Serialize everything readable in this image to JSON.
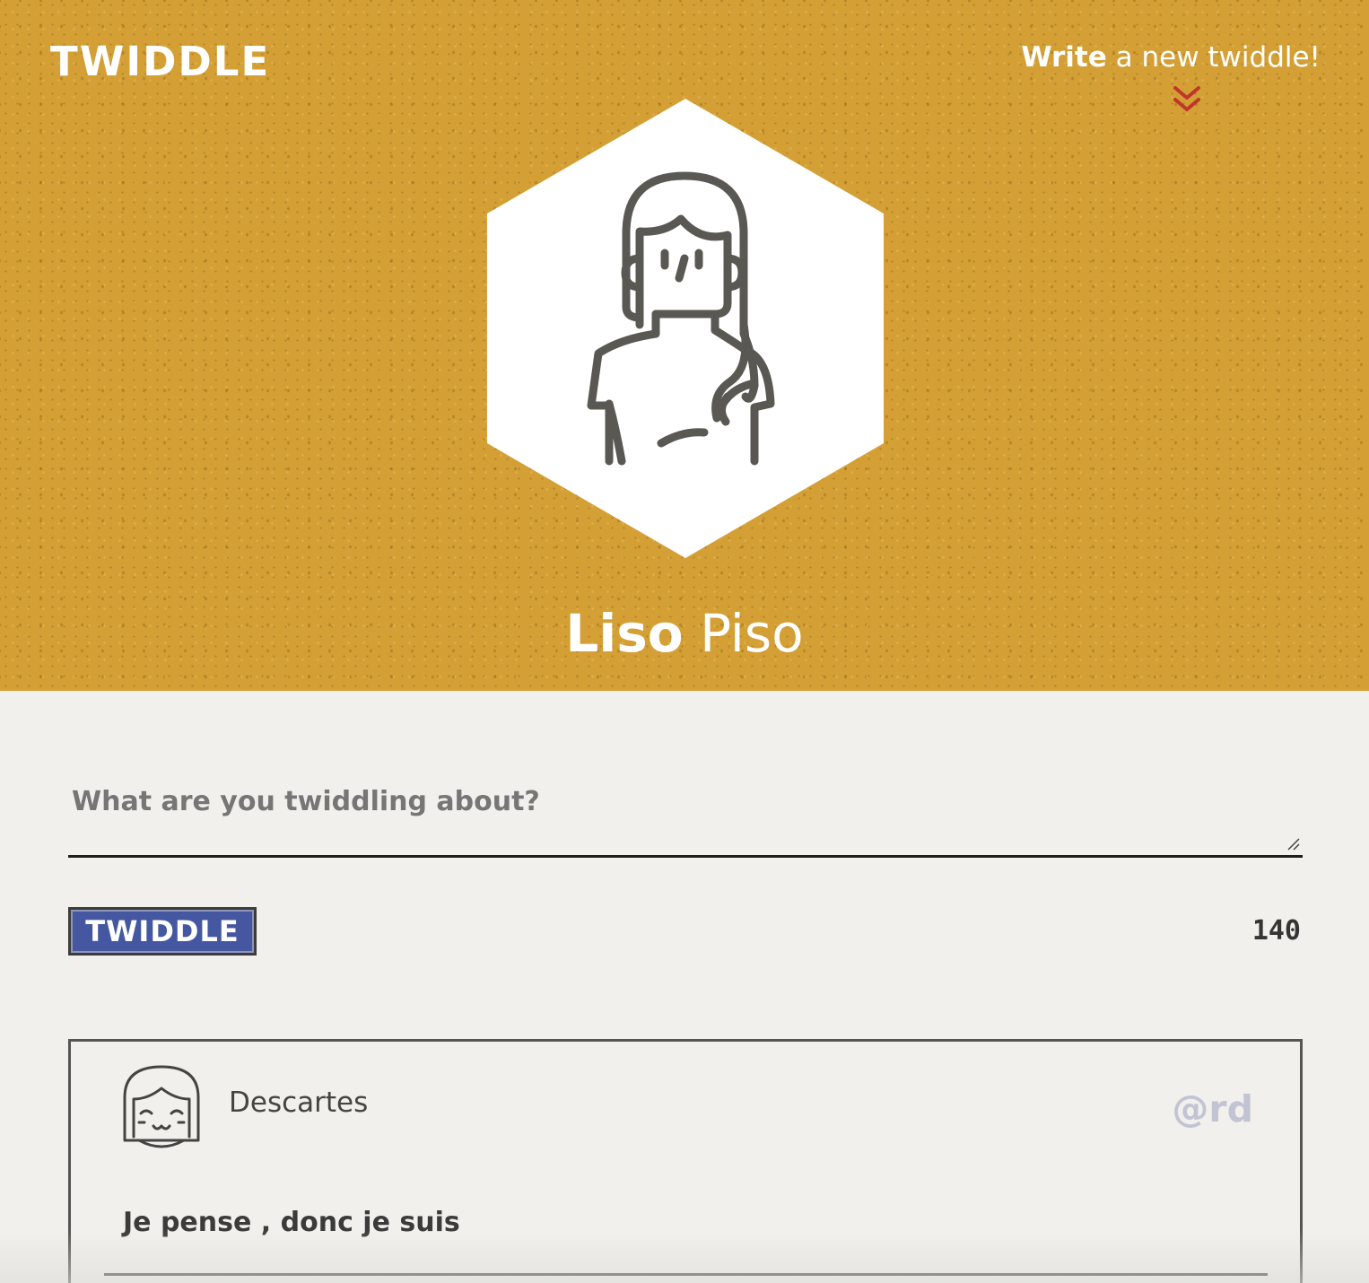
{
  "header": {
    "logo": "TWIDDLE",
    "write_bold": "Write",
    "write_rest": " a new twiddle!",
    "write_icon": "chevron-double-down-icon",
    "profile": {
      "first_name": "Liso",
      "last_name": "Piso",
      "avatar_icon": "woman-avatar-icon"
    }
  },
  "composer": {
    "placeholder": "What are you twiddling about?",
    "value": "",
    "button_label": "TWIDDLE",
    "char_count": "140"
  },
  "feed": [
    {
      "author": "Descartes",
      "handle": "@rd",
      "text": "Je pense , donc je suis",
      "avatar_icon": "girl-face-avatar-icon"
    }
  ],
  "colors": {
    "header_bg": "#d4a035",
    "page_bg": "#f1f0ec",
    "button_bg": "#4557a0",
    "chevron": "#c0362c",
    "handle": "#c2c4d4"
  }
}
